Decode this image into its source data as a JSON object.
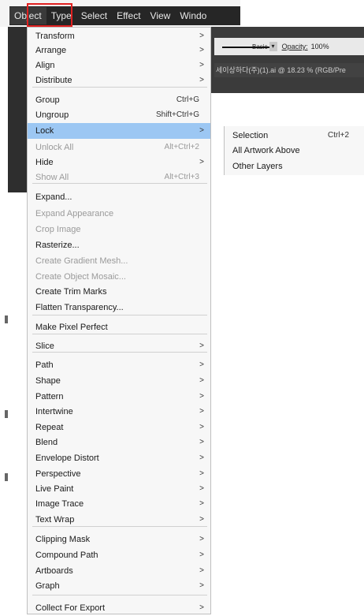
{
  "menubar": {
    "items": [
      "Object",
      "Type",
      "Select",
      "Effect",
      "View",
      "Windo"
    ]
  },
  "toolbar": {
    "stroke_profile": "Basic",
    "opacity_label": "Opacity:",
    "opacity_value": "100%"
  },
  "document_tab": "세이상하다(주)(1).ai @ 18.23 % (RGB/Pre",
  "object_menu": [
    {
      "label": "Transform",
      "arrow": true
    },
    {
      "label": "Arrange",
      "arrow": true
    },
    {
      "label": "Align",
      "arrow": true
    },
    {
      "label": "Distribute",
      "arrow": true
    },
    {
      "label": "Group",
      "shortcut": "Ctrl+G"
    },
    {
      "label": "Ungroup",
      "shortcut": "Shift+Ctrl+G"
    },
    {
      "label": "Lock",
      "arrow": true,
      "highlighted": true
    },
    {
      "label": "Unlock All",
      "shortcut": "Alt+Ctrl+2",
      "disabled": true
    },
    {
      "label": "Hide",
      "arrow": true
    },
    {
      "label": "Show All",
      "shortcut": "Alt+Ctrl+3",
      "disabled": true
    },
    {
      "label": "Expand..."
    },
    {
      "label": "Expand Appearance",
      "disabled": true
    },
    {
      "label": "Crop Image",
      "disabled": true
    },
    {
      "label": "Rasterize..."
    },
    {
      "label": "Create Gradient Mesh...",
      "disabled": true
    },
    {
      "label": "Create Object Mosaic...",
      "disabled": true
    },
    {
      "label": "Create Trim Marks"
    },
    {
      "label": "Flatten Transparency..."
    },
    {
      "label": "Make Pixel Perfect"
    },
    {
      "label": "Slice",
      "arrow": true
    },
    {
      "label": "Path",
      "arrow": true
    },
    {
      "label": "Shape",
      "arrow": true
    },
    {
      "label": "Pattern",
      "arrow": true
    },
    {
      "label": "Intertwine",
      "arrow": true
    },
    {
      "label": "Repeat",
      "arrow": true
    },
    {
      "label": "Blend",
      "arrow": true
    },
    {
      "label": "Envelope Distort",
      "arrow": true
    },
    {
      "label": "Perspective",
      "arrow": true
    },
    {
      "label": "Live Paint",
      "arrow": true
    },
    {
      "label": "Image Trace",
      "arrow": true
    },
    {
      "label": "Text Wrap",
      "arrow": true
    },
    {
      "label": "Clipping Mask",
      "arrow": true
    },
    {
      "label": "Compound Path",
      "arrow": true
    },
    {
      "label": "Artboards",
      "arrow": true
    },
    {
      "label": "Graph",
      "arrow": true
    },
    {
      "label": "Collect For Export",
      "arrow": true
    }
  ],
  "lock_submenu": [
    {
      "label": "Selection",
      "shortcut": "Ctrl+2"
    },
    {
      "label": "All Artwork Above"
    },
    {
      "label": "Other Layers"
    }
  ],
  "arrow_glyph": ">"
}
